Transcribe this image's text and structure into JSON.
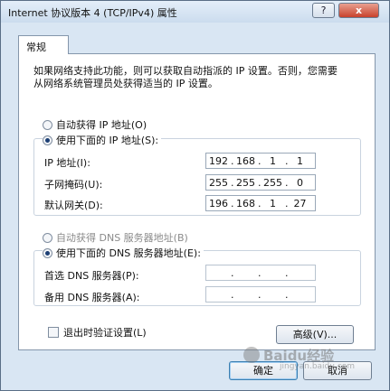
{
  "window": {
    "title": "Internet 协议版本 4 (TCP/IPv4) 属性",
    "help_label": "?",
    "close_label": "x"
  },
  "tabs": [
    {
      "label": "常规"
    }
  ],
  "description": "如果网络支持此功能，则可以获取自动指派的 IP 设置。否则，您需要从网络系统管理员处获得适当的 IP 设置。",
  "ip_section": {
    "auto_label": "自动获得 IP 地址(O)",
    "auto_selected": false,
    "manual_label": "使用下面的 IP 地址(S):",
    "manual_selected": true,
    "fields": [
      {
        "label": "IP 地址(I):",
        "octets": [
          "192",
          "168",
          "1",
          "1"
        ]
      },
      {
        "label": "子网掩码(U):",
        "octets": [
          "255",
          "255",
          "255",
          "0"
        ]
      },
      {
        "label": "默认网关(D):",
        "octets": [
          "196",
          "168",
          "1",
          "27"
        ]
      }
    ]
  },
  "dns_section": {
    "auto_label": "自动获得 DNS 服务器地址(B)",
    "auto_selected": false,
    "manual_label": "使用下面的 DNS 服务器地址(E):",
    "manual_selected": true,
    "fields": [
      {
        "label": "首选 DNS 服务器(P):",
        "octets": [
          "",
          "",
          "",
          ""
        ]
      },
      {
        "label": "备用 DNS 服务器(A):",
        "octets": [
          "",
          "",
          "",
          ""
        ]
      }
    ]
  },
  "validate_label": "退出时验证设置(L)",
  "validate_checked": false,
  "advanced_label": "高级(V)...",
  "ok_label": "确定",
  "cancel_label": "取消",
  "watermark": {
    "text": "Baidu经验",
    "sub": "jingyan.baidu.com"
  }
}
